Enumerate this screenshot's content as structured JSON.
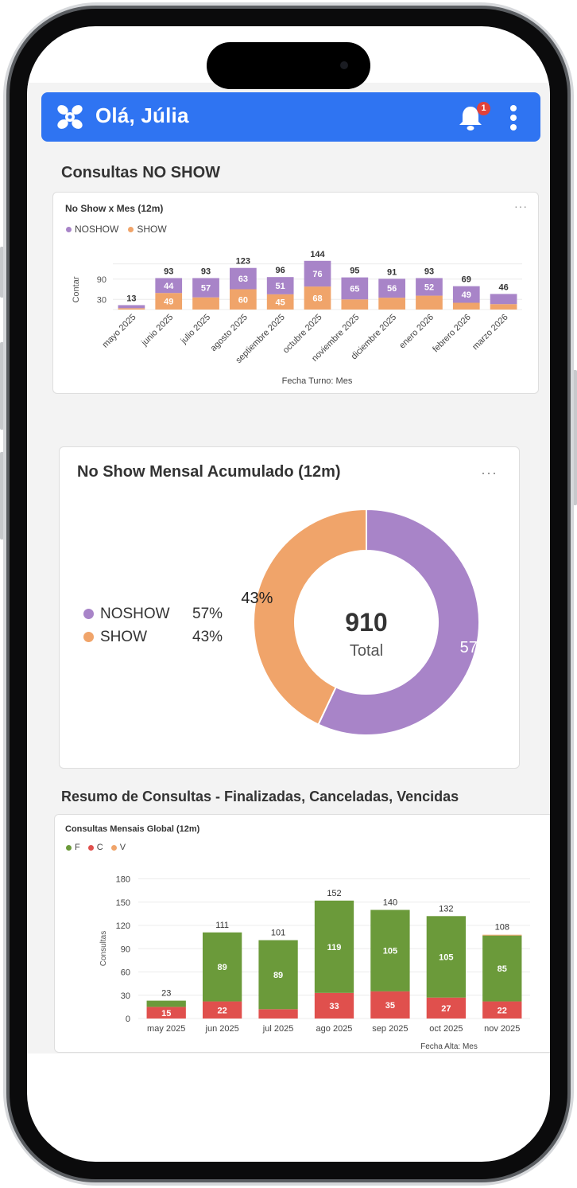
{
  "app": {
    "greeting": "Olá, Júlia",
    "notification_count": "1",
    "brand_color": "#2f74f2"
  },
  "sections": {
    "noshow_title": "Consultas NO SHOW",
    "summary_title": "Resumo de Consultas - Finalizadas, Canceladas, Vencidas"
  },
  "noshow_chart": {
    "title": "No Show x Mes (12m)",
    "menu": "···",
    "legend": [
      {
        "name": "NOSHOW",
        "color": "#a884c8"
      },
      {
        "name": "SHOW",
        "color": "#f0a46a"
      }
    ]
  },
  "donut_card": {
    "title": "No Show Mensal Acumulado (12m)",
    "menu": "···",
    "total_value": "910",
    "total_label": "Total",
    "legend": [
      {
        "name": "NOSHOW",
        "pct": "57%",
        "color": "#a884c8"
      },
      {
        "name": "SHOW",
        "pct": "43%",
        "color": "#f0a46a"
      }
    ]
  },
  "global_chart": {
    "title": "Consultas Mensais Global (12m)",
    "legend": [
      {
        "name": "F",
        "color": "#6b9a3a"
      },
      {
        "name": "C",
        "color": "#e0504d"
      },
      {
        "name": "V",
        "color": "#f0a46a"
      }
    ]
  },
  "chart_data": [
    {
      "type": "bar",
      "stacked": true,
      "title": "No Show x Mes (12m)",
      "xlabel": "Fecha Turno: Mes",
      "ylabel": "Contar",
      "yticks": [
        30,
        90
      ],
      "categories": [
        "mayo 2025",
        "junio 2025",
        "julio 2025",
        "agosto 2025",
        "septiembre 2025",
        "octubre 2025",
        "noviembre 2025",
        "diciembre 2025",
        "enero 2026",
        "febrero 2026",
        "marzo 2026"
      ],
      "totals": [
        13,
        93,
        93,
        123,
        96,
        144,
        95,
        91,
        93,
        69,
        46
      ],
      "series": [
        {
          "name": "SHOW",
          "color": "#f0a46a",
          "values": [
            4,
            49,
            36,
            60,
            45,
            68,
            30,
            35,
            41,
            20,
            16
          ],
          "labels": [
            null,
            "49",
            null,
            "60",
            "45",
            "68",
            null,
            null,
            null,
            null,
            null
          ]
        },
        {
          "name": "NOSHOW",
          "color": "#a884c8",
          "values": [
            9,
            44,
            57,
            63,
            51,
            76,
            65,
            56,
            52,
            49,
            30
          ],
          "labels": [
            null,
            "44",
            "57",
            "63",
            "51",
            "76",
            "65",
            "56",
            "52",
            "49",
            null
          ]
        }
      ],
      "legend_position": "top-left",
      "grid": true
    },
    {
      "type": "pie",
      "donut": true,
      "title": "No Show Mensal Acumulado (12m)",
      "total": 910,
      "slices": [
        {
          "name": "NOSHOW",
          "value": 57,
          "label": "57%",
          "color": "#a884c8"
        },
        {
          "name": "SHOW",
          "value": 43,
          "label": "43%",
          "color": "#f0a46a"
        }
      ],
      "legend_position": "left"
    },
    {
      "type": "bar",
      "stacked": true,
      "title": "Consultas Mensais Global (12m)",
      "xlabel": "Fecha Alta: Mes",
      "ylabel": "Consultas",
      "ylim": [
        0,
        180
      ],
      "yticks": [
        0,
        30,
        60,
        90,
        120,
        150,
        180
      ],
      "categories": [
        "may 2025",
        "jun 2025",
        "jul 2025",
        "ago 2025",
        "sep 2025",
        "oct 2025",
        "nov 2025"
      ],
      "totals": [
        23,
        111,
        101,
        152,
        140,
        132,
        108
      ],
      "series": [
        {
          "name": "C",
          "color": "#e0504d",
          "values": [
            15,
            22,
            12,
            33,
            35,
            27,
            22
          ],
          "labels": [
            "15",
            "22",
            null,
            "33",
            "35",
            "27",
            "22"
          ]
        },
        {
          "name": "F",
          "color": "#6b9a3a",
          "values": [
            8,
            89,
            89,
            119,
            105,
            105,
            85
          ],
          "labels": [
            null,
            "89",
            "89",
            "119",
            "105",
            "105",
            "85"
          ]
        },
        {
          "name": "V",
          "color": "#f0a46a",
          "values": [
            0,
            0,
            0,
            0,
            0,
            0,
            1
          ],
          "labels": [
            null,
            null,
            null,
            null,
            null,
            null,
            null
          ]
        }
      ],
      "legend_position": "top-left",
      "grid": true
    }
  ]
}
